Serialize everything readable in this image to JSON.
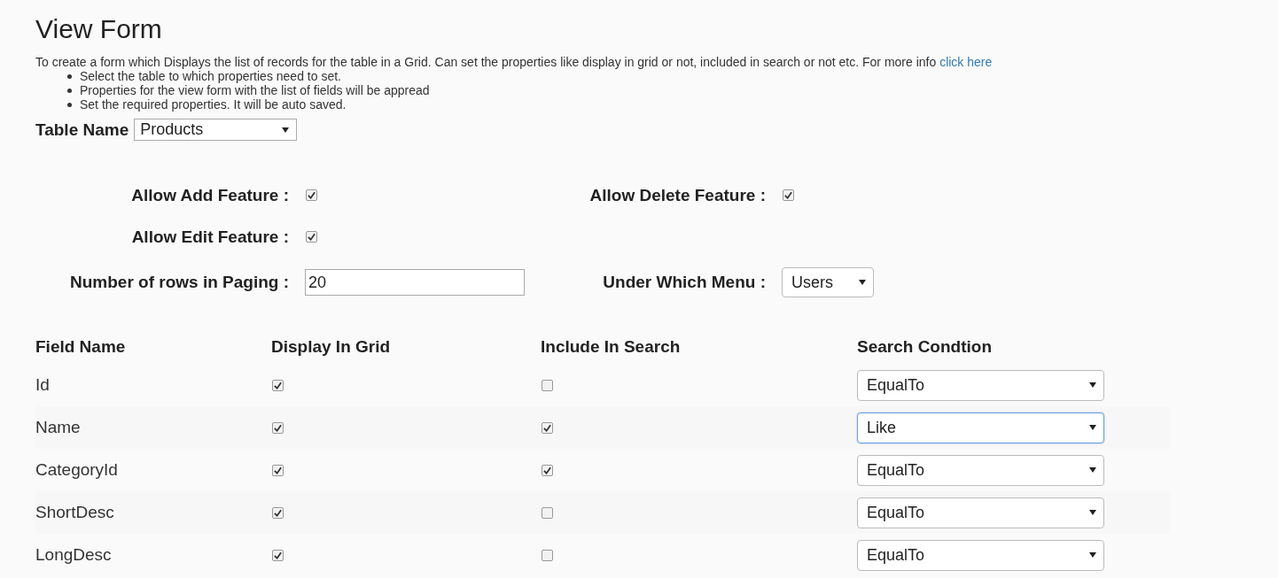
{
  "title": "View Form",
  "description": {
    "text": "To create a form which Displays the list of records for the table in a Grid. Can set the properties like display in grid or not, included in search or not etc. For more info ",
    "link": "click here"
  },
  "steps": [
    "Select the table to which properties need to set.",
    "Properties for the view form with the list of fields will be appread",
    "Set the required properties. It will be auto saved."
  ],
  "table_name": {
    "label": "Table Name",
    "value": "Products"
  },
  "settings": [
    {
      "items": [
        {
          "label": "Allow Add Feature :",
          "kind": "checkbox",
          "checked": true
        },
        {
          "label": "Allow Delete Feature :",
          "kind": "checkbox",
          "checked": true
        }
      ]
    },
    {
      "items": [
        {
          "label": "Allow Edit Feature :",
          "kind": "checkbox",
          "checked": true
        }
      ]
    },
    {
      "items": [
        {
          "label": "Number of rows in Paging :",
          "kind": "text",
          "value": "20"
        },
        {
          "label": "Under Which Menu :",
          "kind": "select",
          "value": "Users"
        }
      ]
    }
  ],
  "fields": {
    "columns": [
      "Field Name",
      "Display In Grid",
      "Include In Search",
      "Search Condtion"
    ],
    "rows": [
      {
        "name": "Id",
        "display_in_grid": true,
        "include_in_search": false,
        "condition": "EqualTo",
        "focused": false
      },
      {
        "name": "Name",
        "display_in_grid": true,
        "include_in_search": true,
        "condition": "Like",
        "focused": true
      },
      {
        "name": "CategoryId",
        "display_in_grid": true,
        "include_in_search": true,
        "condition": "EqualTo",
        "focused": false
      },
      {
        "name": "ShortDesc",
        "display_in_grid": true,
        "include_in_search": false,
        "condition": "EqualTo",
        "focused": false
      },
      {
        "name": "LongDesc",
        "display_in_grid": true,
        "include_in_search": false,
        "condition": "EqualTo",
        "focused": false
      }
    ]
  }
}
